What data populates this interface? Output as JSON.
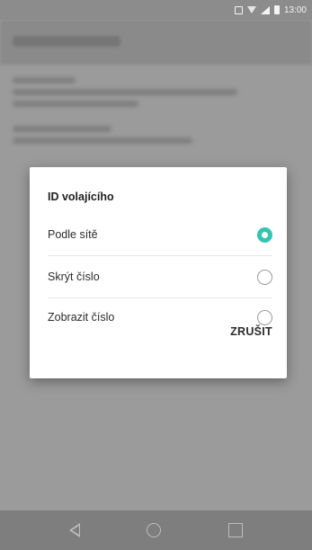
{
  "status_bar": {
    "time": "13:00",
    "icons": [
      "nfc-icon",
      "wifi-icon",
      "signal-icon",
      "battery-icon"
    ]
  },
  "dialog": {
    "title": "ID volajícího",
    "options": [
      {
        "label": "Podle sítě",
        "selected": true
      },
      {
        "label": "Skrýt číslo",
        "selected": false
      },
      {
        "label": "Zobrazit číslo",
        "selected": false
      }
    ],
    "cancel_label": "ZRUŠIT"
  },
  "colors": {
    "accent": "#35c3b2",
    "scrim": "#9a9a9a"
  },
  "nav_bar": {
    "icons": [
      "back-icon",
      "home-icon",
      "recent-apps-icon"
    ]
  }
}
